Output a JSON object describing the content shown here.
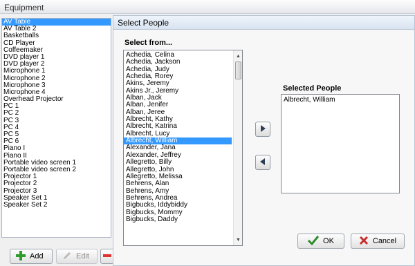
{
  "equipment": {
    "title": "Equipment",
    "items": [
      "AV Table",
      "AV Table 2",
      "Basketballs",
      "CD Player",
      "Coffeemaker",
      "DVD player 1",
      "DVD player 2",
      "Microphone 1",
      "Microphone 2",
      "Microphone 3",
      "Microphone 4",
      "Overhead Projector",
      "PC 1",
      "PC 2",
      "PC 3",
      "PC 4",
      "PC 5",
      "PC 6",
      "Piano I",
      "Piano II",
      "Portable video screen 1",
      "Portable video screen 2",
      "Projector 1",
      "Projector 2",
      "Projector 3",
      "Speaker Set 1",
      "Speaker Set 2"
    ],
    "selected_index": 0,
    "add_label": "Add",
    "edit_label": "Edit"
  },
  "dialog": {
    "title": "Select People",
    "select_from_label": "Select from...",
    "selected_people_label": "Selected People",
    "people": [
      "Achedia, Celina",
      "Achedia, Jackson",
      "Achedia, Judy",
      "Achedia, Rorey",
      "Akins, Jeremy",
      "Akins Jr., Jeremy",
      "Alban, Jack",
      "Alban, Jenifer",
      "Alban, Jeree",
      "Albrecht, Kathy",
      "Albrecht, Katrina",
      "Albrecht, Lucy",
      "Albrecht, William",
      "Alexander, Jana",
      "Alexander, Jeffrey",
      "Allegretto, Billy",
      "Allegretto, John",
      "Allegretto, Melissa",
      "Behrens, Alan",
      "Behrens, Amy",
      "Behrens, Andrea",
      "Bigbucks, Iddybiddy",
      "Bigbucks, Mommy",
      "Bigbucks, Daddy"
    ],
    "highlighted_index": 12,
    "selected_people": [
      "Albrecht, William"
    ],
    "ok_label": "OK",
    "cancel_label": "Cancel"
  }
}
